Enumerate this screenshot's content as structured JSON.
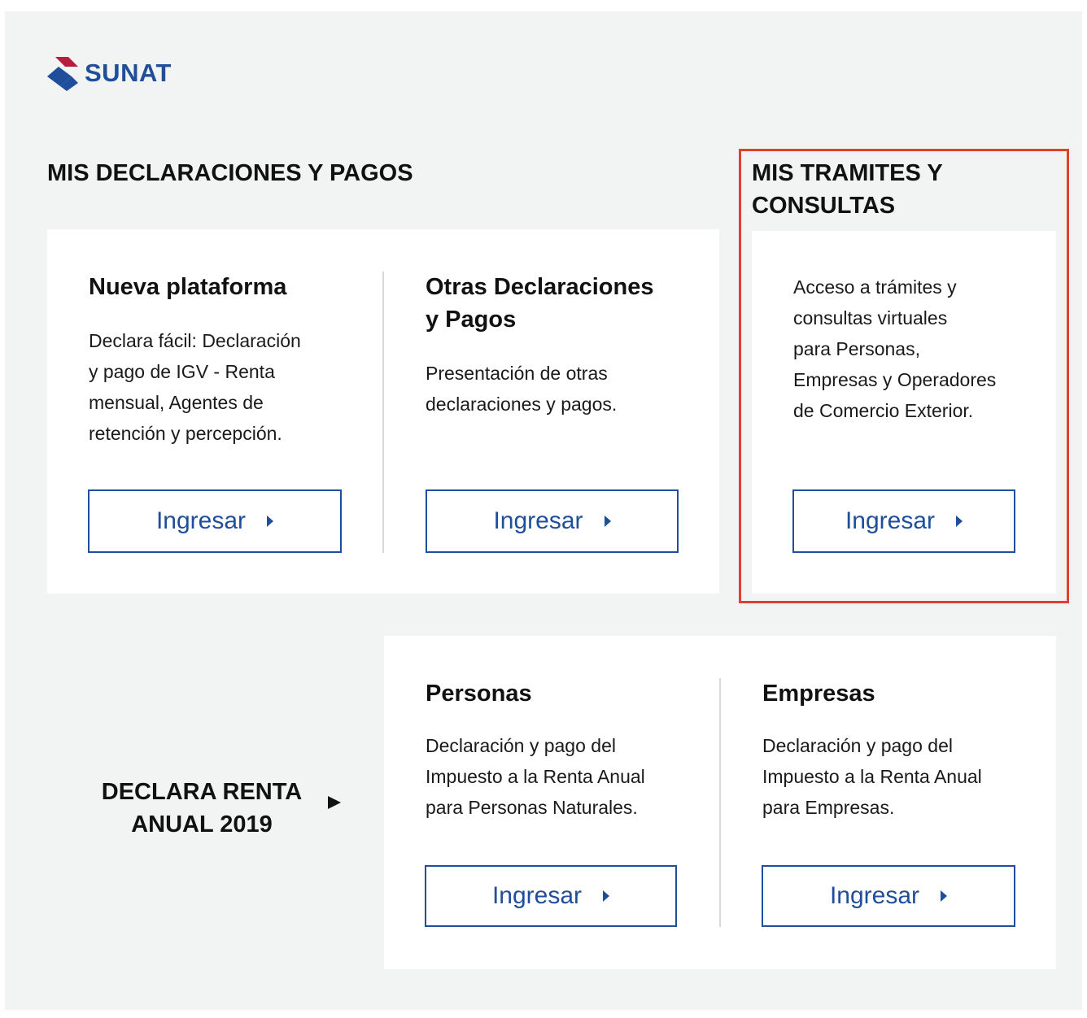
{
  "brand": {
    "logo_text": "SUNAT",
    "colors": {
      "primary": "#1f4e9b",
      "accent": "#b51f3d",
      "highlight": "#e0402e"
    }
  },
  "declaraciones": {
    "title": "MIS DECLARACIONES Y PAGOS",
    "nueva": {
      "title": "Nueva plataforma",
      "desc": [
        "Declara fácil: Declaración",
        "y pago de IGV - Renta",
        "mensual, Agentes de",
        "retención y percepción."
      ],
      "button": "Ingresar"
    },
    "otras": {
      "title": [
        "Otras Declaraciones",
        "y Pagos"
      ],
      "desc": [
        "Presentación de otras",
        "declaraciones y pagos."
      ],
      "button": "Ingresar"
    }
  },
  "tramites": {
    "title": [
      "MIS TRAMITES Y",
      "CONSULTAS"
    ],
    "desc": [
      "Acceso a trámites y",
      "consultas virtuales",
      "para Personas,",
      "Empresas y Operadores",
      "de Comercio Exterior."
    ],
    "button": "Ingresar"
  },
  "renta": {
    "title": [
      "DECLARA RENTA",
      "ANUAL 2019"
    ],
    "personas": {
      "title": "Personas",
      "desc": [
        "Declaración y pago del",
        "Impuesto a la Renta Anual",
        "para Personas Naturales."
      ],
      "button": "Ingresar"
    },
    "empresas": {
      "title": "Empresas",
      "desc": [
        "Declaración y pago del",
        "Impuesto a la Renta Anual",
        "para Empresas."
      ],
      "button": "Ingresar"
    }
  }
}
